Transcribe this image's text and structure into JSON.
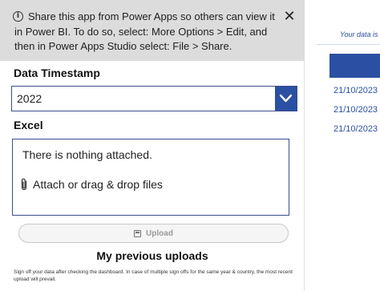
{
  "banner": {
    "text": "Share this app from Power Apps so others can view it in Power BI. To do so, select: More Options > Edit, and then in Power Apps Studio select: File > Share.",
    "info_glyph": "i",
    "close_glyph": "✕"
  },
  "form": {
    "timestamp_label": "Data Timestamp",
    "timestamp_value": "2022",
    "excel_label": "Excel",
    "attachments_empty_text": "There is nothing attached.",
    "attach_text": "Attach or drag & drop files",
    "upload_label": "Upload"
  },
  "uploads": {
    "title": "My previous uploads",
    "note": "Sign off your data after checking the dashboard. In case of multiple sign offs for the same year & country, the most recent upload will prevail."
  },
  "dashboard": {
    "note": "Your data is",
    "header": "S",
    "dates": [
      "21/10/2023",
      "21/10/2023",
      "21/10/2023"
    ]
  },
  "colors": {
    "accent": "#2b4fa2",
    "banner_bg": "#dcdcdc"
  },
  "icons": {
    "banner_info": "info-circle-icon",
    "banner_close": "close-icon",
    "dropdown": "chevron-down-icon",
    "attach": "paperclip-icon",
    "upload": "save-icon"
  }
}
